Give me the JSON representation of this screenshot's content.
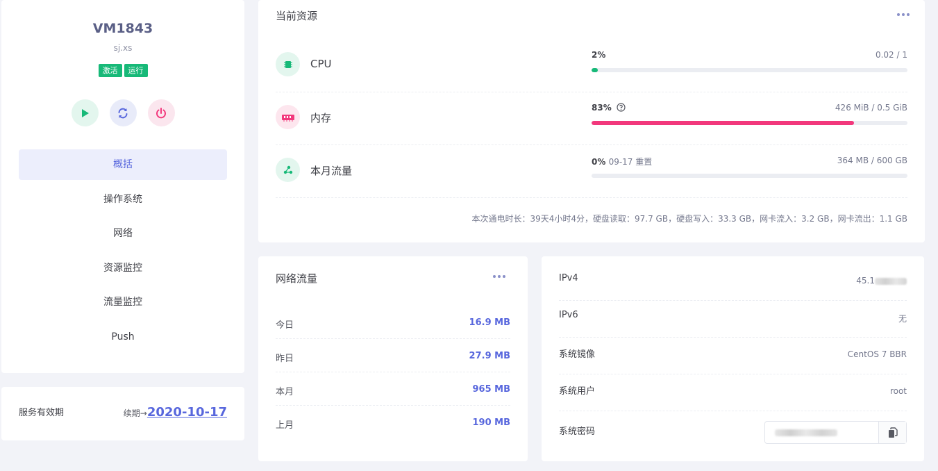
{
  "profile": {
    "vm_name": "VM1843",
    "host": "sj.xs",
    "badges": [
      "激活",
      "运行"
    ],
    "menu": [
      {
        "label": "概括",
        "active": true
      },
      {
        "label": "操作系统",
        "active": false
      },
      {
        "label": "网络",
        "active": false
      },
      {
        "label": "资源监控",
        "active": false
      },
      {
        "label": "流量监控",
        "active": false
      },
      {
        "label": "Push",
        "active": false
      }
    ]
  },
  "validity": {
    "label": "服务有效期",
    "renew_label": "续期→",
    "date": "2020-10-17"
  },
  "resources": {
    "title": "当前资源",
    "rows": [
      {
        "name": "CPU",
        "percent": "2%",
        "sub": "",
        "value": "0.02 / 1",
        "fill": 0.02,
        "color": "#17b978",
        "icon": "cpu-icon"
      },
      {
        "name": "内存",
        "percent": "83%",
        "sub": "",
        "value": "426 MiB / 0.5 GiB",
        "fill": 0.83,
        "color": "#f2387c",
        "icon": "memory-icon"
      },
      {
        "name": "本月流量",
        "percent": "0%",
        "sub": "09-17 重置",
        "value": "364 MB / 600 GB",
        "fill": 0.0,
        "color": "#17b978",
        "icon": "traffic-icon"
      }
    ],
    "footer": "本次通电时长：39天4小时4分，硬盘读取：97.7 GB，硬盘写入：33.3 GB，网卡流入：3.2 GB，网卡流出：1.1 GB"
  },
  "traffic": {
    "title": "网络流量",
    "rows": [
      {
        "label": "今日",
        "value": "16.9 MB"
      },
      {
        "label": "昨日",
        "value": "27.9 MB"
      },
      {
        "label": "本月",
        "value": "965 MB"
      },
      {
        "label": "上月",
        "value": "190 MB"
      }
    ]
  },
  "info": {
    "ipv4_label": "IPv4",
    "ipv4_value": "45.1",
    "ipv6_label": "IPv6",
    "ipv6_value": "无",
    "image_label": "系统镜像",
    "image_value": "CentOS 7 BBR",
    "user_label": "系统用户",
    "user_value": "root",
    "password_label": "系统密码"
  },
  "colors": {
    "accent": "#5867dd",
    "success": "#17b978",
    "danger": "#f2387c"
  }
}
